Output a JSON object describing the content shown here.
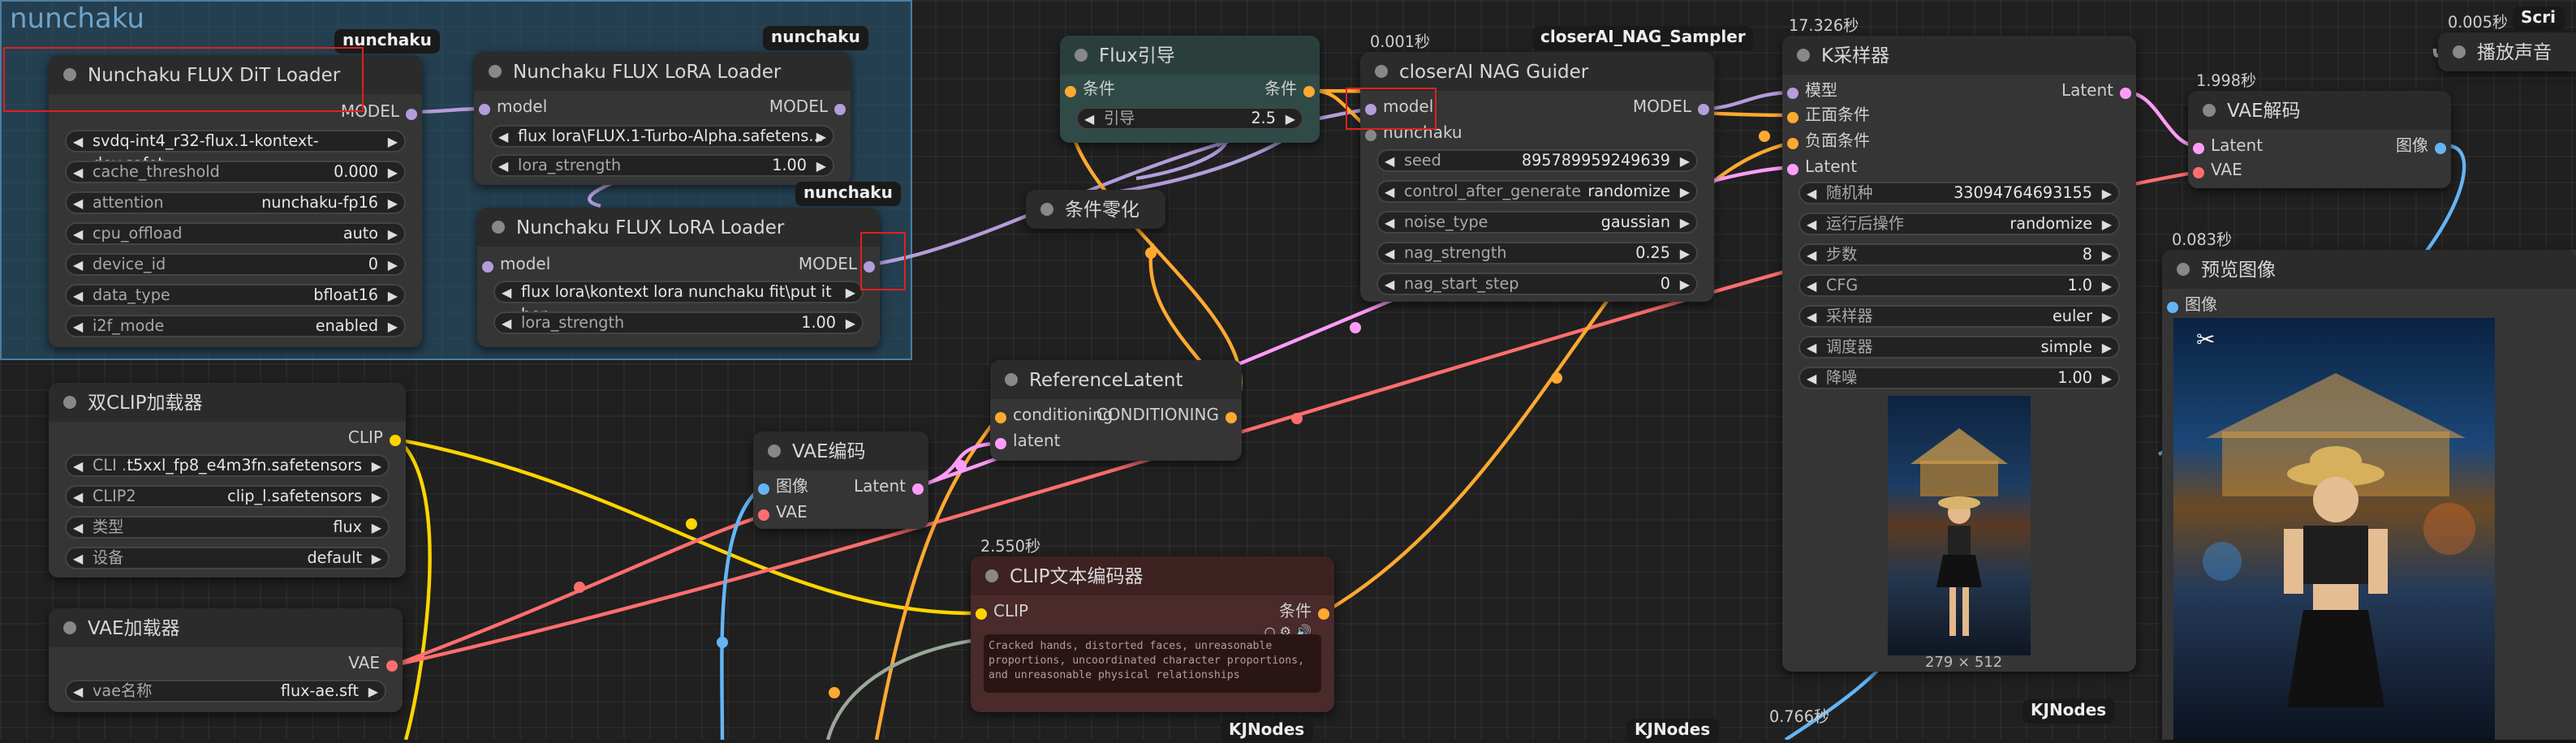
{
  "group": {
    "title": "nunchaku"
  },
  "colors": {
    "model": "#b39ddb",
    "clip": "#ffd500",
    "vae": "#ff6e6e",
    "conditioning": "#ffa931",
    "latent": "#ff9cf9",
    "image": "#64b5f6"
  },
  "nodes": {
    "dit_loader": {
      "title": "Nunchaku FLUX DiT Loader",
      "badge": "nunchaku",
      "output": "MODEL",
      "widgets": [
        {
          "label": "svdq-int4_r32-flux.1-kontext-dev.safet...",
          "value": ""
        },
        {
          "label": "cache_threshold",
          "value": "0.000"
        },
        {
          "label": "attention",
          "value": "nunchaku-fp16"
        },
        {
          "label": "cpu_offload",
          "value": "auto"
        },
        {
          "label": "device_id",
          "value": "0"
        },
        {
          "label": "data_type",
          "value": "bfloat16"
        },
        {
          "label": "i2f_mode",
          "value": "enabled"
        }
      ]
    },
    "lora1": {
      "title": "Nunchaku FLUX LoRA Loader",
      "badge": "nunchaku",
      "input": "model",
      "output": "MODEL",
      "widgets": [
        {
          "label": "flux lora\\FLUX.1-Turbo-Alpha.safetens...",
          "value": ""
        },
        {
          "label": "lora_strength",
          "value": "1.00"
        }
      ]
    },
    "lora2": {
      "title": "Nunchaku FLUX LoRA Loader",
      "badge": "nunchaku",
      "input": "model",
      "output": "MODEL",
      "widgets": [
        {
          "label": "flux lora\\kontext lora nunchaku fit\\put it her...",
          "value": ""
        },
        {
          "label": "lora_strength",
          "value": "1.00"
        }
      ]
    },
    "dual_clip": {
      "title": "双CLIP加载器",
      "output": "CLIP",
      "widgets": [
        {
          "label": "CLI ...",
          "value": "t5xxl_fp8_e4m3fn.safetensors"
        },
        {
          "label": "CLIP2",
          "value": "clip_l.safetensors"
        },
        {
          "label": "类型",
          "value": "flux"
        },
        {
          "label": "设备",
          "value": "default"
        }
      ]
    },
    "vae_loader": {
      "title": "VAE加载器",
      "output": "VAE",
      "widgets": [
        {
          "label": "vae名称",
          "value": "flux-ae.sft"
        }
      ]
    },
    "vae_encode": {
      "title": "VAE编码",
      "inputs": [
        "图像",
        "VAE"
      ],
      "output": "Latent"
    },
    "flux_guidance": {
      "title": "Flux引导",
      "input": "条件",
      "output": "条件",
      "widgets": [
        {
          "label": "引导",
          "value": "2.5"
        }
      ]
    },
    "cond_zero": {
      "title": "条件零化"
    },
    "reference_latent": {
      "title": "ReferenceLatent",
      "inputs": [
        "conditioning",
        "latent"
      ],
      "output": "CONDITIONING"
    },
    "clip_encoder": {
      "title": "CLIP文本编码器",
      "timing": "2.550秒",
      "input": "CLIP",
      "output": "条件",
      "text": "Cracked hands, distorted faces, unreasonable proportions, uncoordinated character proportions, and unreasonable physical relationships"
    },
    "nag_guider": {
      "title": "closerAI NAG Guider",
      "timing": "0.001秒",
      "badge": "closerAI_NAG_Sampler",
      "inputs": [
        "model",
        "nunchaku"
      ],
      "output": "MODEL",
      "widgets": [
        {
          "label": "seed",
          "value": "895789959249639"
        },
        {
          "label": "control_after_generate",
          "value": "randomize"
        },
        {
          "label": "noise_type",
          "value": "gaussian"
        },
        {
          "label": "nag_strength",
          "value": "0.25"
        },
        {
          "label": "nag_start_step",
          "value": "0"
        }
      ]
    },
    "ksampler": {
      "title": "K采样器",
      "timing": "17.326秒",
      "inputs": [
        "模型",
        "正面条件",
        "负面条件",
        "Latent"
      ],
      "output": "Latent",
      "widgets": [
        {
          "label": "随机种",
          "value": "33094764693155"
        },
        {
          "label": "运行后操作",
          "value": "randomize"
        },
        {
          "label": "步数",
          "value": "8"
        },
        {
          "label": "CFG",
          "value": "1.0"
        },
        {
          "label": "采样器",
          "value": "euler"
        },
        {
          "label": "调度器",
          "value": "simple"
        },
        {
          "label": "降噪",
          "value": "1.00"
        }
      ],
      "preview_size": "279 × 512",
      "badge": "KJNodes"
    },
    "vae_decode": {
      "title": "VAE解码",
      "timing": "1.998秒",
      "inputs": [
        "Latent",
        "VAE"
      ],
      "output": "图像"
    },
    "preview": {
      "title": "预览图像",
      "timing": "0.083秒",
      "input": "图像"
    },
    "play_sound": {
      "title": "播放声音",
      "timing": "0.005秒",
      "badge": "Scri"
    }
  },
  "misc": {
    "timing_bottom": "0.766秒",
    "kjnodes_a": "KJNodes",
    "kjnodes_b": "KJNodes"
  }
}
